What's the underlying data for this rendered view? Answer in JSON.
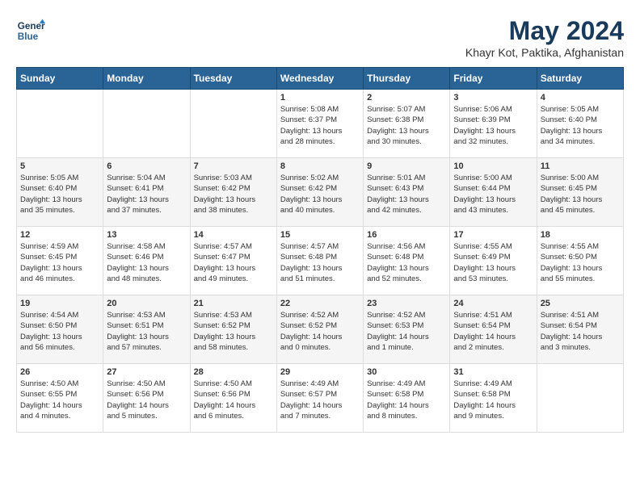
{
  "header": {
    "logo_line1": "General",
    "logo_line2": "Blue",
    "month_year": "May 2024",
    "location": "Khayr Kot, Paktika, Afghanistan"
  },
  "weekdays": [
    "Sunday",
    "Monday",
    "Tuesday",
    "Wednesday",
    "Thursday",
    "Friday",
    "Saturday"
  ],
  "weeks": [
    [
      {
        "day": "",
        "content": ""
      },
      {
        "day": "",
        "content": ""
      },
      {
        "day": "",
        "content": ""
      },
      {
        "day": "1",
        "content": "Sunrise: 5:08 AM\nSunset: 6:37 PM\nDaylight: 13 hours\nand 28 minutes."
      },
      {
        "day": "2",
        "content": "Sunrise: 5:07 AM\nSunset: 6:38 PM\nDaylight: 13 hours\nand 30 minutes."
      },
      {
        "day": "3",
        "content": "Sunrise: 5:06 AM\nSunset: 6:39 PM\nDaylight: 13 hours\nand 32 minutes."
      },
      {
        "day": "4",
        "content": "Sunrise: 5:05 AM\nSunset: 6:40 PM\nDaylight: 13 hours\nand 34 minutes."
      }
    ],
    [
      {
        "day": "5",
        "content": "Sunrise: 5:05 AM\nSunset: 6:40 PM\nDaylight: 13 hours\nand 35 minutes."
      },
      {
        "day": "6",
        "content": "Sunrise: 5:04 AM\nSunset: 6:41 PM\nDaylight: 13 hours\nand 37 minutes."
      },
      {
        "day": "7",
        "content": "Sunrise: 5:03 AM\nSunset: 6:42 PM\nDaylight: 13 hours\nand 38 minutes."
      },
      {
        "day": "8",
        "content": "Sunrise: 5:02 AM\nSunset: 6:42 PM\nDaylight: 13 hours\nand 40 minutes."
      },
      {
        "day": "9",
        "content": "Sunrise: 5:01 AM\nSunset: 6:43 PM\nDaylight: 13 hours\nand 42 minutes."
      },
      {
        "day": "10",
        "content": "Sunrise: 5:00 AM\nSunset: 6:44 PM\nDaylight: 13 hours\nand 43 minutes."
      },
      {
        "day": "11",
        "content": "Sunrise: 5:00 AM\nSunset: 6:45 PM\nDaylight: 13 hours\nand 45 minutes."
      }
    ],
    [
      {
        "day": "12",
        "content": "Sunrise: 4:59 AM\nSunset: 6:45 PM\nDaylight: 13 hours\nand 46 minutes."
      },
      {
        "day": "13",
        "content": "Sunrise: 4:58 AM\nSunset: 6:46 PM\nDaylight: 13 hours\nand 48 minutes."
      },
      {
        "day": "14",
        "content": "Sunrise: 4:57 AM\nSunset: 6:47 PM\nDaylight: 13 hours\nand 49 minutes."
      },
      {
        "day": "15",
        "content": "Sunrise: 4:57 AM\nSunset: 6:48 PM\nDaylight: 13 hours\nand 51 minutes."
      },
      {
        "day": "16",
        "content": "Sunrise: 4:56 AM\nSunset: 6:48 PM\nDaylight: 13 hours\nand 52 minutes."
      },
      {
        "day": "17",
        "content": "Sunrise: 4:55 AM\nSunset: 6:49 PM\nDaylight: 13 hours\nand 53 minutes."
      },
      {
        "day": "18",
        "content": "Sunrise: 4:55 AM\nSunset: 6:50 PM\nDaylight: 13 hours\nand 55 minutes."
      }
    ],
    [
      {
        "day": "19",
        "content": "Sunrise: 4:54 AM\nSunset: 6:50 PM\nDaylight: 13 hours\nand 56 minutes."
      },
      {
        "day": "20",
        "content": "Sunrise: 4:53 AM\nSunset: 6:51 PM\nDaylight: 13 hours\nand 57 minutes."
      },
      {
        "day": "21",
        "content": "Sunrise: 4:53 AM\nSunset: 6:52 PM\nDaylight: 13 hours\nand 58 minutes."
      },
      {
        "day": "22",
        "content": "Sunrise: 4:52 AM\nSunset: 6:52 PM\nDaylight: 14 hours\nand 0 minutes."
      },
      {
        "day": "23",
        "content": "Sunrise: 4:52 AM\nSunset: 6:53 PM\nDaylight: 14 hours\nand 1 minute."
      },
      {
        "day": "24",
        "content": "Sunrise: 4:51 AM\nSunset: 6:54 PM\nDaylight: 14 hours\nand 2 minutes."
      },
      {
        "day": "25",
        "content": "Sunrise: 4:51 AM\nSunset: 6:54 PM\nDaylight: 14 hours\nand 3 minutes."
      }
    ],
    [
      {
        "day": "26",
        "content": "Sunrise: 4:50 AM\nSunset: 6:55 PM\nDaylight: 14 hours\nand 4 minutes."
      },
      {
        "day": "27",
        "content": "Sunrise: 4:50 AM\nSunset: 6:56 PM\nDaylight: 14 hours\nand 5 minutes."
      },
      {
        "day": "28",
        "content": "Sunrise: 4:50 AM\nSunset: 6:56 PM\nDaylight: 14 hours\nand 6 minutes."
      },
      {
        "day": "29",
        "content": "Sunrise: 4:49 AM\nSunset: 6:57 PM\nDaylight: 14 hours\nand 7 minutes."
      },
      {
        "day": "30",
        "content": "Sunrise: 4:49 AM\nSunset: 6:58 PM\nDaylight: 14 hours\nand 8 minutes."
      },
      {
        "day": "31",
        "content": "Sunrise: 4:49 AM\nSunset: 6:58 PM\nDaylight: 14 hours\nand 9 minutes."
      },
      {
        "day": "",
        "content": ""
      }
    ]
  ]
}
